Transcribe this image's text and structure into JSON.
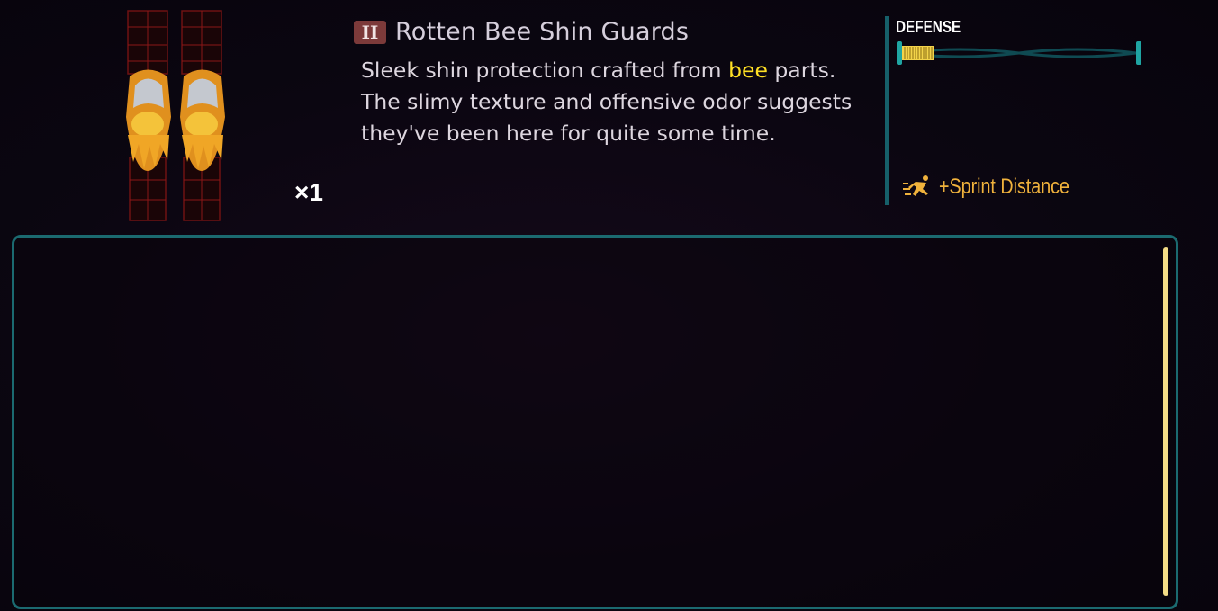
{
  "item": {
    "name": "Rotten Bee Shin Guards",
    "tier": "II",
    "quantity": "×1",
    "description_parts": {
      "before": "Sleek shin protection crafted from ",
      "highlight": "bee",
      "after": " parts. The slimy texture and offensive odor suggests they've been here for quite some time."
    },
    "image_icon": "shin-guards-icon"
  },
  "stats": {
    "defense_label": "DEFENSE",
    "defense_fill": 0.14,
    "perk_label": "+Sprint Distance",
    "perk_icon": "sprint-icon"
  },
  "colors": {
    "tier_badge": "#7c3a3a",
    "highlight": "#ffe024",
    "accent_teal": "#1b6a70",
    "perk": "#f0b23c",
    "scrollbar": "#f3dc86"
  }
}
